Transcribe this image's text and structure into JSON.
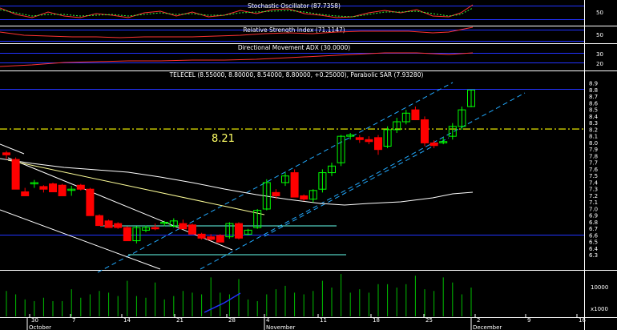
{
  "chart_data": {
    "type": "candlestick",
    "panels": {
      "stochastic": {
        "title": "Stochastic Oscillator (87.7358)",
        "yticks": [
          "50"
        ]
      },
      "rsi": {
        "title": "Relative Strength Index (71.1147)",
        "yticks": [
          "50"
        ]
      },
      "adx": {
        "title": "Directional Movement ADX (30.0000)",
        "yticks": [
          "30",
          "20"
        ]
      },
      "price": {
        "title": "TELECEL (8.55000, 8.80000, 8.54000, 8.80000, +0.25000), Parabolic SAR (7.93280)",
        "ylim": [
          6.2,
          8.95
        ],
        "yticks": [
          "8.9",
          "8.8",
          "8.7",
          "8.6",
          "8.5",
          "8.4",
          "8.3",
          "8.2",
          "8.1",
          "8.0",
          "7.9",
          "7.8",
          "7.7",
          "7.6",
          "7.5",
          "7.4",
          "7.3",
          "7.2",
          "7.1",
          "7.0",
          "6.9",
          "6.8",
          "6.7",
          "6.6",
          "6.5",
          "6.4",
          "6.3"
        ],
        "level_line": 8.21,
        "level_label": "8.21"
      },
      "volume": {
        "yticks": [
          "10000"
        ],
        "unit_label": "x1000"
      }
    },
    "xaxis": {
      "day_labels": [
        "30",
        "7",
        "14",
        "21",
        "28",
        "4",
        "11",
        "18",
        "25",
        "2",
        "9",
        "16"
      ],
      "month_labels": [
        "October",
        "November",
        "December"
      ]
    },
    "candles": [
      {
        "o": 7.85,
        "h": 7.88,
        "l": 7.75,
        "c": 7.82
      },
      {
        "o": 7.75,
        "h": 7.78,
        "l": 7.3,
        "c": 7.3
      },
      {
        "o": 7.26,
        "h": 7.32,
        "l": 7.2,
        "c": 7.2
      },
      {
        "o": 7.38,
        "h": 7.44,
        "l": 7.32,
        "c": 7.4
      },
      {
        "o": 7.34,
        "h": 7.36,
        "l": 7.25,
        "c": 7.3
      },
      {
        "o": 7.38,
        "h": 7.4,
        "l": 7.26,
        "c": 7.26
      },
      {
        "o": 7.36,
        "h": 7.38,
        "l": 7.2,
        "c": 7.2
      },
      {
        "o": 7.3,
        "h": 7.35,
        "l": 7.2,
        "c": 7.3
      },
      {
        "o": 7.36,
        "h": 7.38,
        "l": 7.28,
        "c": 7.3
      },
      {
        "o": 7.3,
        "h": 7.32,
        "l": 6.9,
        "c": 6.9
      },
      {
        "o": 6.9,
        "h": 6.92,
        "l": 6.75,
        "c": 6.75
      },
      {
        "o": 6.82,
        "h": 6.84,
        "l": 6.72,
        "c": 6.72
      },
      {
        "o": 6.78,
        "h": 6.8,
        "l": 6.7,
        "c": 6.72
      },
      {
        "o": 6.72,
        "h": 6.74,
        "l": 6.52,
        "c": 6.52
      },
      {
        "o": 6.52,
        "h": 6.74,
        "l": 6.48,
        "c": 6.72
      },
      {
        "o": 6.68,
        "h": 6.75,
        "l": 6.65,
        "c": 6.72
      },
      {
        "o": 6.72,
        "h": 6.78,
        "l": 6.68,
        "c": 6.7
      },
      {
        "o": 6.8,
        "h": 6.82,
        "l": 6.74,
        "c": 6.8
      },
      {
        "o": 6.74,
        "h": 6.86,
        "l": 6.72,
        "c": 6.82
      },
      {
        "o": 6.78,
        "h": 6.84,
        "l": 6.7,
        "c": 6.7
      },
      {
        "o": 6.76,
        "h": 6.78,
        "l": 6.62,
        "c": 6.62
      },
      {
        "o": 6.62,
        "h": 6.64,
        "l": 6.54,
        "c": 6.56
      },
      {
        "o": 6.58,
        "h": 6.62,
        "l": 6.52,
        "c": 6.54
      },
      {
        "o": 6.6,
        "h": 6.62,
        "l": 6.5,
        "c": 6.5
      },
      {
        "o": 6.58,
        "h": 6.8,
        "l": 6.55,
        "c": 6.78
      },
      {
        "o": 6.78,
        "h": 6.8,
        "l": 6.54,
        "c": 6.56
      },
      {
        "o": 6.62,
        "h": 6.7,
        "l": 6.6,
        "c": 6.68
      },
      {
        "o": 6.72,
        "h": 7.0,
        "l": 6.7,
        "c": 6.98
      },
      {
        "o": 7.0,
        "h": 7.45,
        "l": 6.98,
        "c": 7.4
      },
      {
        "o": 7.25,
        "h": 7.3,
        "l": 7.15,
        "c": 7.2
      },
      {
        "o": 7.4,
        "h": 7.55,
        "l": 7.35,
        "c": 7.5
      },
      {
        "o": 7.55,
        "h": 7.6,
        "l": 7.18,
        "c": 7.18
      },
      {
        "o": 7.2,
        "h": 7.22,
        "l": 7.12,
        "c": 7.15
      },
      {
        "o": 7.15,
        "h": 7.3,
        "l": 7.1,
        "c": 7.28
      },
      {
        "o": 7.3,
        "h": 7.6,
        "l": 7.25,
        "c": 7.55
      },
      {
        "o": 7.55,
        "h": 7.7,
        "l": 7.5,
        "c": 7.65
      },
      {
        "o": 7.7,
        "h": 8.12,
        "l": 7.65,
        "c": 8.1
      },
      {
        "o": 8.1,
        "h": 8.15,
        "l": 8.05,
        "c": 8.12
      },
      {
        "o": 8.08,
        "h": 8.12,
        "l": 8.0,
        "c": 8.05
      },
      {
        "o": 8.05,
        "h": 8.1,
        "l": 7.98,
        "c": 8.02
      },
      {
        "o": 8.08,
        "h": 8.12,
        "l": 7.82,
        "c": 7.9
      },
      {
        "o": 7.95,
        "h": 8.25,
        "l": 7.92,
        "c": 8.2
      },
      {
        "o": 8.2,
        "h": 8.38,
        "l": 8.15,
        "c": 8.32
      },
      {
        "o": 8.32,
        "h": 8.5,
        "l": 8.28,
        "c": 8.45
      },
      {
        "o": 8.5,
        "h": 8.55,
        "l": 8.4,
        "c": 8.35
      },
      {
        "o": 8.35,
        "h": 8.4,
        "l": 7.95,
        "c": 8.0
      },
      {
        "o": 8.0,
        "h": 8.04,
        "l": 7.92,
        "c": 7.96
      },
      {
        "o": 8.02,
        "h": 8.08,
        "l": 7.98,
        "c": 8.02
      },
      {
        "o": 8.1,
        "h": 8.3,
        "l": 8.05,
        "c": 8.25
      },
      {
        "o": 8.25,
        "h": 8.55,
        "l": 8.2,
        "c": 8.5
      },
      {
        "o": 8.55,
        "h": 8.8,
        "l": 8.54,
        "c": 8.8
      }
    ],
    "volume": [
      1500,
      1300,
      1000,
      900,
      1100,
      900,
      900,
      1600,
      1100,
      1300,
      1500,
      1400,
      1200,
      2100,
      1200,
      1100,
      2000,
      1000,
      1200,
      1500,
      1400,
      1300,
      2300,
      1400,
      1300,
      2200,
      1000,
      900,
      1300,
      1600,
      1800,
      1400,
      1300,
      1500,
      2100,
      1700,
      2500,
      1400,
      1600,
      1400,
      1900,
      1900,
      1700,
      1900,
      2400,
      1600,
      1500,
      2300,
      2000,
      1300,
      1700
    ]
  },
  "colors": {
    "up": "#00ff00",
    "down": "#ff0000",
    "channel": "#22aaff",
    "level": "#ffff00",
    "sma": "#ffffff",
    "trend": "#ffff99",
    "grid": "#2233ff",
    "volume": "#00c000"
  }
}
